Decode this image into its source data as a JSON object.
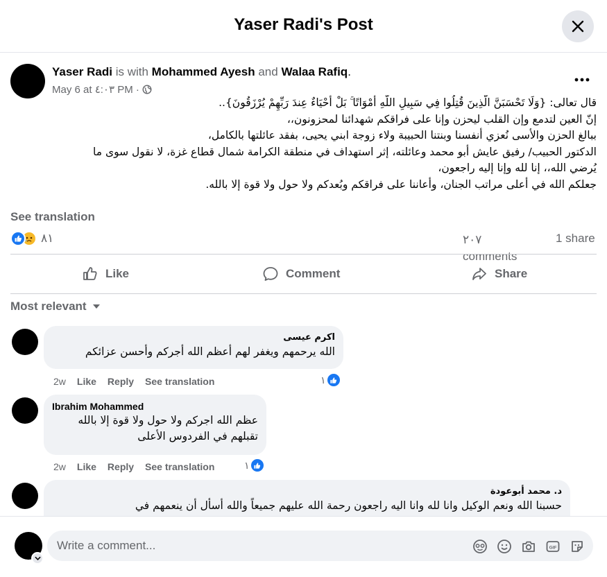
{
  "header": {
    "title": "Yaser Radi's Post"
  },
  "post": {
    "author": "Yaser Radi",
    "with_text": "is with",
    "tagged1": "Mohammed Ayesh",
    "and_text": "and",
    "tagged2": "Walaa Rafiq",
    "period": ".",
    "date": "May 6 at ٤:٠٣ PM ·",
    "privacy_icon": "globe-icon",
    "lines": [
      "قال تعالى: {وَلَا تَحْسَبَنَّ الَّذِينَ قُتِلُوا فِي سَبِيلِ اللَّهِ أَمْوَاتًا ۚ بَلْ أَحْيَاءٌ عِندَ رَبِّهِمْ يُرْزَقُونَ}..",
      "إنّ العين لتدمع وإن القلب ليحزن وإنا على فراقكم شهدائنا لمحزونون،،",
      "ببالغ الحزن والأسى نُعزي أنفسنا وبنتنا الحبيبة ولاء زوجة ابني يحيى، بفقد عائلتها بالكامل،",
      "الدكتور الحبيب/ رفيق عايش أبو محمد وعائلته، إثر استهداف في منطقة الكرامة شمال قطاع غزة، لا نقول سوى ما",
      "يُرضي الله،، إنا لله وإنا إليه راجعون،",
      "جعلكم الله في أعلى مراتب الجنان، وأعاننا على فراقكم وبُعدكم ولا حول ولا قوة إلا بالله."
    ],
    "see_translation": "See translation",
    "reaction_count": "٨١",
    "comments_count": "٢٠٧ comments",
    "shares_count": "1 share"
  },
  "actions": {
    "like": "Like",
    "comment": "Comment",
    "share": "Share"
  },
  "sort_label": "Most relevant",
  "comments": [
    {
      "name": "اكرم عيسى",
      "text_lines": [
        "الله يرحمهم ويغفر لهم أعظم الله أجركم وأحسن عزائكم"
      ],
      "time": "2w",
      "like": "Like",
      "reply": "Reply",
      "see_translation": "See translation",
      "likes": "١"
    },
    {
      "name": "Ibrahim Mohammed",
      "text_lines": [
        "عظم الله اجركم ولا حول ولا قوة إلا بالله",
        "تقبلهم في الفردوس الأعلى"
      ],
      "time": "2w",
      "like": "Like",
      "reply": "Reply",
      "see_translation": "See translation",
      "likes": "١"
    },
    {
      "name": "د. محمد أبوعودة",
      "text_lines": [
        "حسبنا الله ونعم الوكيل وانا لله وانا اليه راجعون رحمة الله عليهم جميعاً والله أسأل أن ينعمهم في"
      ]
    }
  ],
  "composer": {
    "placeholder": "Write a comment..."
  },
  "colors": {
    "accent": "#1877f2",
    "muted": "#65676b",
    "bubble": "#f0f2f5",
    "divider": "#ced0d4"
  }
}
